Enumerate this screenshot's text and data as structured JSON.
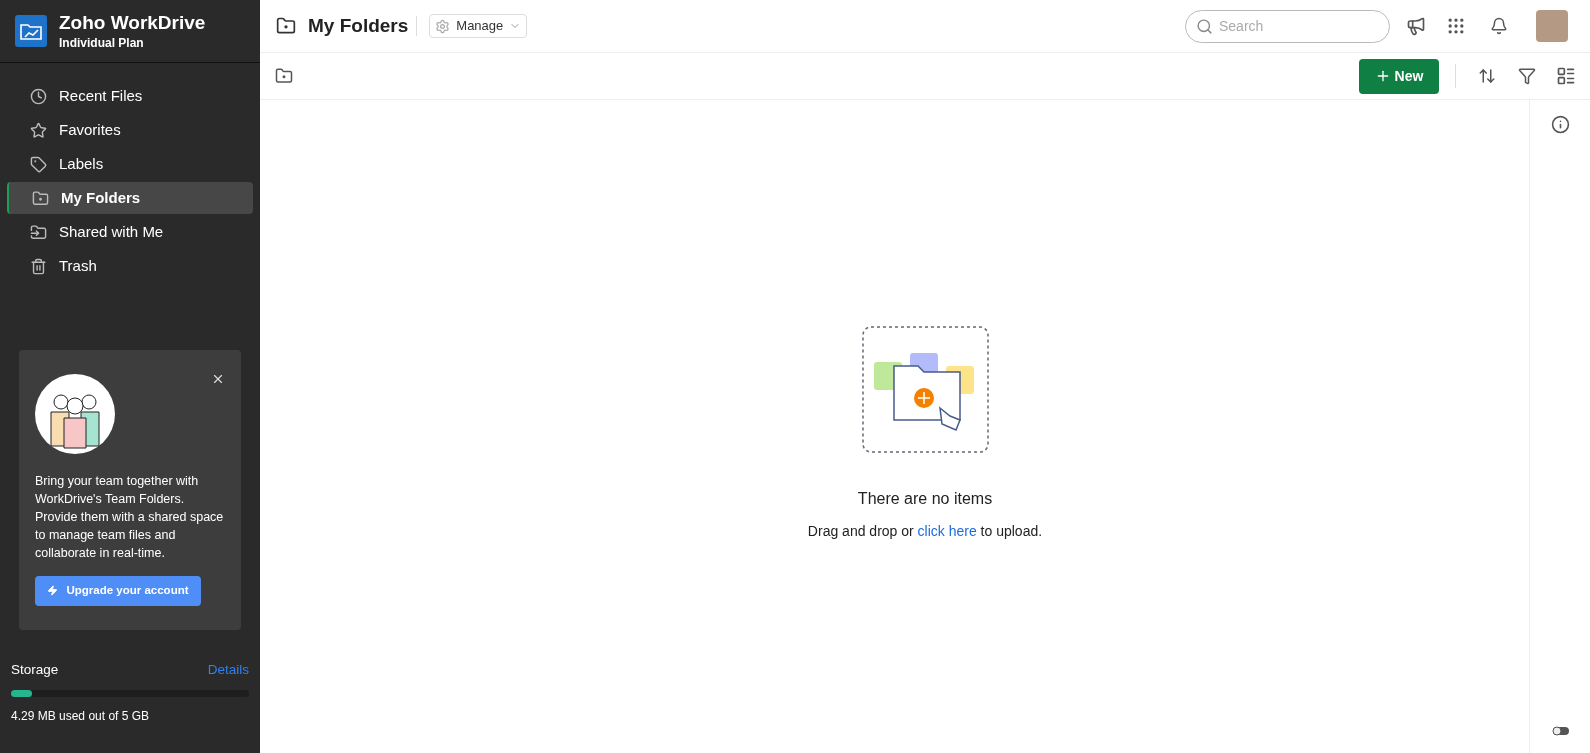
{
  "brand": {
    "name": "Zoho WorkDrive",
    "plan": "Individual Plan"
  },
  "nav": [
    {
      "label": "Recent Files",
      "kind": "recent",
      "selected": false
    },
    {
      "label": "Favorites",
      "kind": "favorites",
      "selected": false
    },
    {
      "label": "Labels",
      "kind": "labels",
      "selected": false
    },
    {
      "label": "My Folders",
      "kind": "folders",
      "selected": true
    },
    {
      "label": "Shared with Me",
      "kind": "shared",
      "selected": false
    },
    {
      "label": "Trash",
      "kind": "trash",
      "selected": false
    }
  ],
  "promo": {
    "text": "Bring your team together with WorkDrive's Team Folders. Provide them with a shared space to manage team files and collaborate in real-time.",
    "button": "Upgrade your account"
  },
  "storage": {
    "label": "Storage",
    "link": "Details",
    "level": 0.09,
    "usage": "4.29 MB used out of 5 GB"
  },
  "header": {
    "title": "My Folders",
    "manage": "Manage",
    "search": {
      "placeholder": "Search"
    }
  },
  "toolbar": {
    "new_button": "New"
  },
  "empty": {
    "title": "There are no items",
    "before": "Drag and drop or ",
    "link": "click here",
    "after": " to upload."
  }
}
